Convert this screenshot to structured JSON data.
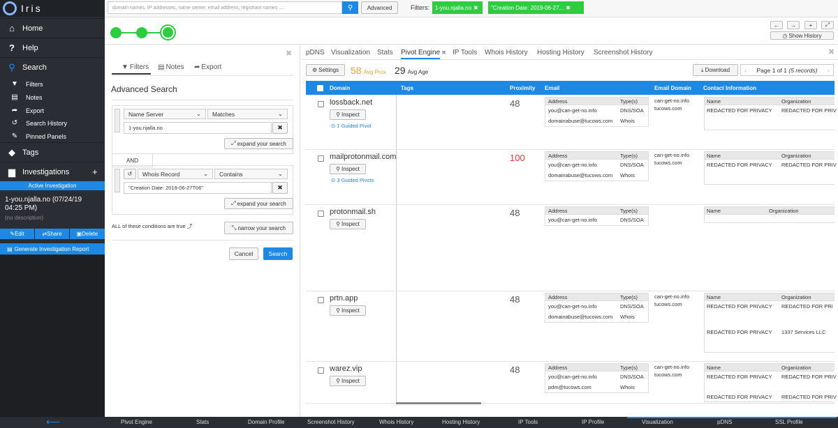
{
  "app": {
    "name": "Iris"
  },
  "sidebar": {
    "home": "Home",
    "help": "Help",
    "search": "Search",
    "sub": [
      "Filters",
      "Notes",
      "Export",
      "Search History",
      "Pinned Panels"
    ],
    "tags": "Tags",
    "investigations": "Investigations",
    "plus": "+",
    "active_label": "Active Investigation",
    "inv_title": "1-you.njalla.no (07/24/19 04:25 PM)",
    "inv_desc": "(no description)",
    "edit": "Edit",
    "share": "Share",
    "delete": "Delete",
    "report": "Generate Investigation Report"
  },
  "topbar": {
    "search_placeholder": "domain names, IP addresses, name server, email address, registrant names ...",
    "advanced": "Advanced",
    "filters_label": "Filters:",
    "chip1": "1-you.njalla.no",
    "chip2": "\"Creation Date: 2019-06-27..."
  },
  "controls": {
    "show_history": "Show History"
  },
  "left_panel": {
    "tabs": [
      "Filters",
      "Notes",
      "Export"
    ],
    "title": "Advanced Search",
    "cond1": {
      "field": "Name Server",
      "op": "Matches",
      "value": "1-you.njalla.no"
    },
    "and": "AND",
    "cond2": {
      "field": "Whois Record",
      "op": "Contains",
      "value": "\"Creation Date: 2019-06-27T06\""
    },
    "expand": "expand your search",
    "narrow": "narrow your search",
    "all_true": "ALL of these conditions are true",
    "cancel": "Cancel",
    "search": "Search"
  },
  "main": {
    "tabs": [
      "pDNS",
      "Visualization",
      "Stats",
      "Pivot Engine",
      "IP Tools",
      "Whois History",
      "Hosting History",
      "Screenshot History"
    ],
    "settings": "Settings",
    "avg_prox_val": "58",
    "avg_prox_lbl": "Avg Prox",
    "avg_age_val": "29",
    "avg_age_lbl": "Avg Age",
    "download": "Download",
    "pager": "Page 1 of 1",
    "records": "(5 records)",
    "headers": [
      "Domain",
      "Tags",
      "Proximity",
      "Email",
      "Email Domain",
      "Contact Information"
    ],
    "inspect": "Inspect",
    "sub_headers": {
      "address": "Address",
      "types": "Type(s)",
      "name": "Name",
      "org": "Organization"
    },
    "rows": [
      {
        "domain": "lossback.net",
        "pivot": "1 Guided Pivot",
        "prox": "48",
        "emails": [
          [
            "you@can-get-no.info",
            "DNS/SOA"
          ],
          [
            "domainabuse@tucows.com",
            "Whois"
          ]
        ],
        "edomains": [
          "can-get-no.info",
          "tucows.com"
        ],
        "contacts": [
          [
            "REDACTED FOR PRIVACY",
            "REDACTED FOR PRIV"
          ]
        ]
      },
      {
        "domain": "mailprotonmail.com",
        "pivot": "3 Guided Pivots",
        "prox": "100",
        "emails": [
          [
            "you@can-get-no.info",
            "DNS/SOA"
          ],
          [
            "domainabuse@tucows.com",
            "Whois"
          ]
        ],
        "edomains": [
          "can-get-no.info",
          "tucows.com"
        ],
        "contacts": [
          [
            "REDACTED FOR PRIVACY",
            "REDACTED FOR PRIV"
          ]
        ]
      },
      {
        "domain": "protonmail.sh",
        "pivot": "",
        "prox": "48",
        "emails": [
          [
            "you@can-get-no.info",
            "DNS/SOA"
          ]
        ],
        "edomains": [],
        "contacts": []
      },
      {
        "domain": "prtn.app",
        "pivot": "",
        "prox": "48",
        "emails": [
          [
            "you@can-get-no.info",
            "DNS/SOA"
          ],
          [
            "domainabuse@tucows.com",
            "Whois"
          ]
        ],
        "edomains": [
          "can-get-no.info",
          "tucows.com"
        ],
        "contacts": [
          [
            "REDACTED FOR PRIVACY",
            "REDACTED FOR PRI"
          ],
          [
            "REDACTED FOR PRIVACY",
            "1337 Services LLC"
          ]
        ]
      },
      {
        "domain": "warez.vip",
        "pivot": "",
        "prox": "48",
        "emails": [
          [
            "you@can-get-no.info",
            "DNS/SOA"
          ],
          [
            "pdm@tucows.com",
            "Whois"
          ]
        ],
        "edomains": [
          "can-get-no.info",
          "tucows.com"
        ],
        "contacts": [
          [
            "REDACTED FOR PRIVACY",
            "REDACTED FOR PRIV"
          ],
          [
            "REDACTED FOR PRIVACY",
            "REDACTED FOR PRIV"
          ]
        ]
      }
    ]
  },
  "bottom": [
    "Pivot Engine",
    "Stats",
    "Domain Profile",
    "Screenshot History",
    "Whois History",
    "Hosting History",
    "IP Tools",
    "IP Profile",
    "Visualization",
    "pDNS",
    "SSL Profile"
  ],
  "colors": {
    "accent": "#1e88e5",
    "green": "#2ecc40",
    "sidebar": "#2a2d33",
    "orange": "#f0a040",
    "red": "#e53935"
  }
}
